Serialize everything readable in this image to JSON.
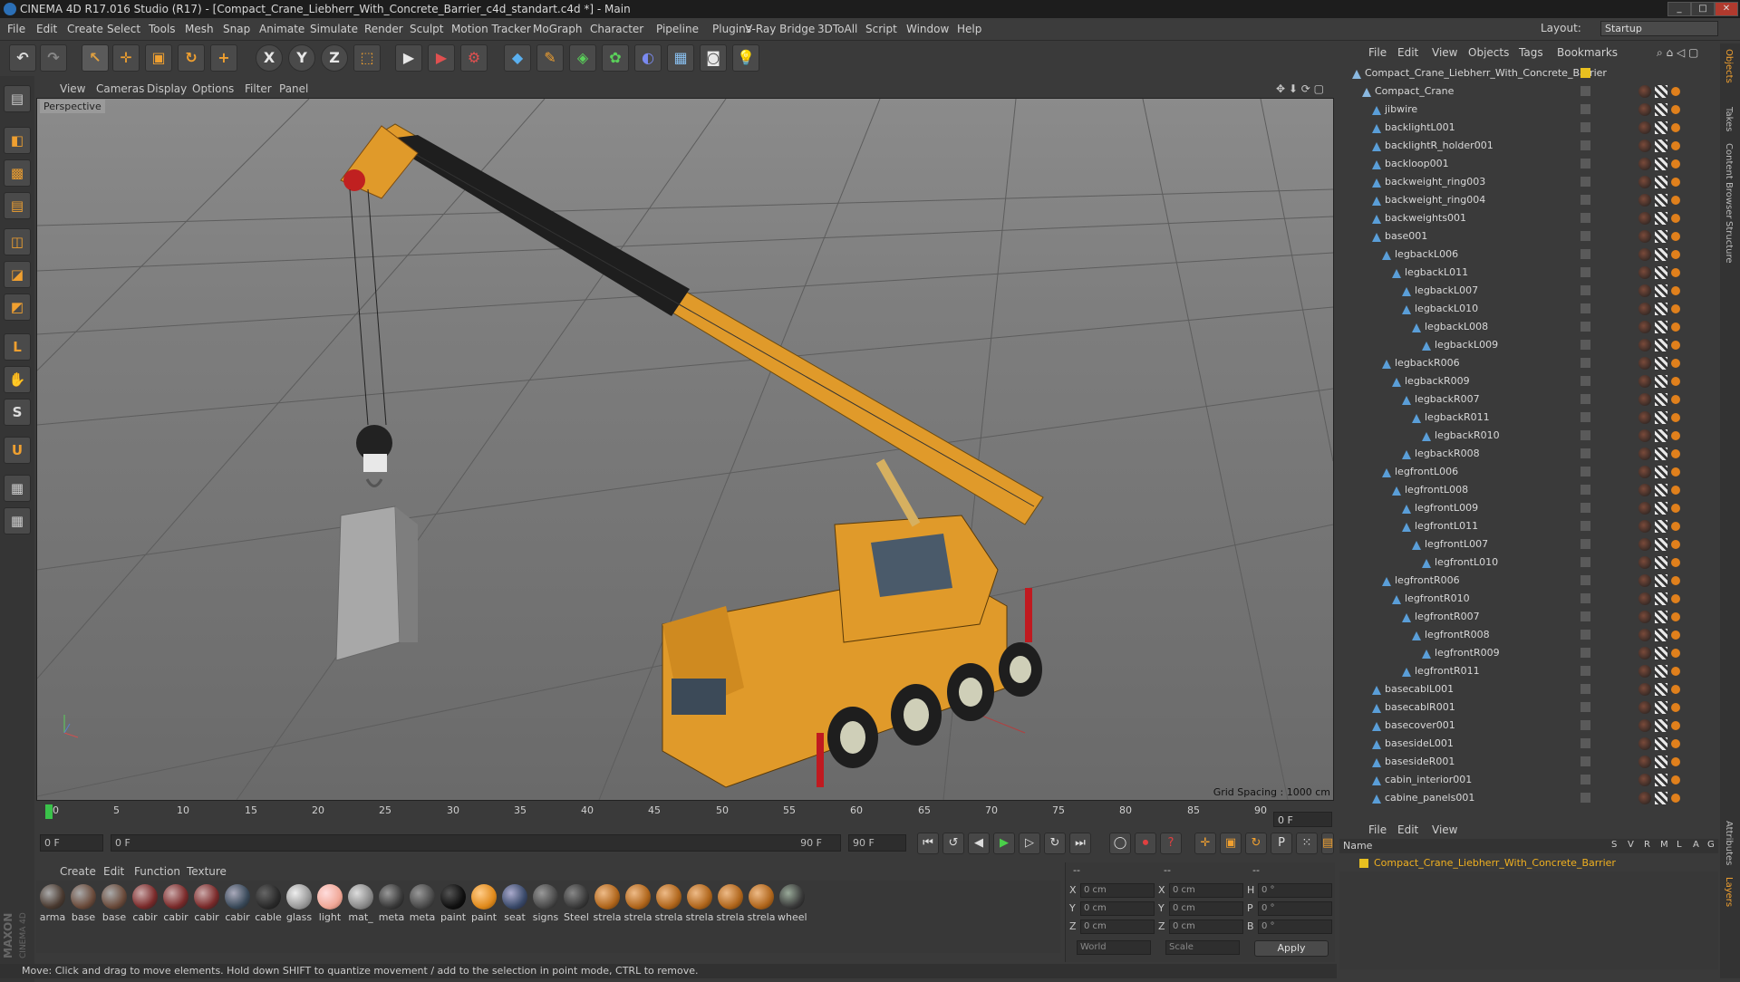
{
  "window": {
    "title": "CINEMA 4D R17.016 Studio (R17) - [Compact_Crane_Liebherr_With_Concrete_Barrier_c4d_standart.c4d *] - Main",
    "minimize": "_",
    "maximize": "□",
    "close": "✕"
  },
  "menu": [
    "File",
    "Edit",
    "Create",
    "Select",
    "Tools",
    "Mesh",
    "Snap",
    "Animate",
    "Simulate",
    "Render",
    "Sculpt",
    "Motion Tracker",
    "MoGraph",
    "Character",
    "Pipeline",
    "Plugins",
    "V-Ray Bridge",
    "3DToAll",
    "Script",
    "Window",
    "Help"
  ],
  "layout": {
    "label": "Layout:",
    "value": "Startup"
  },
  "toolbar": {
    "x": "X",
    "y": "Y",
    "z": "Z"
  },
  "viewport": {
    "menu": [
      "View",
      "Cameras",
      "Display",
      "Options",
      "Filter",
      "Panel"
    ],
    "label": "Perspective",
    "grid_spacing": "Grid Spacing : 1000 cm"
  },
  "timeline": {
    "ticks": [
      "0",
      "5",
      "10",
      "15",
      "20",
      "25",
      "30",
      "35",
      "40",
      "45",
      "50",
      "55",
      "60",
      "65",
      "70",
      "75",
      "80",
      "85",
      "90"
    ],
    "end_frame": "0 F",
    "current": "0 F",
    "range_start": "0 F",
    "range_end": "90 F",
    "range_end2": "90 F"
  },
  "materials": {
    "menu": [
      "Create",
      "Edit",
      "Function",
      "Texture"
    ],
    "items": [
      {
        "label": "arma",
        "color": "#4a3a30"
      },
      {
        "label": "base",
        "color": "#6a4a3a"
      },
      {
        "label": "base",
        "color": "#6a4a3a"
      },
      {
        "label": "cabir",
        "color": "#7a2a2a"
      },
      {
        "label": "cabir",
        "color": "#7a2a2a"
      },
      {
        "label": "cabir",
        "color": "#7a2a2a"
      },
      {
        "label": "cabir",
        "color": "#3a4a5a"
      },
      {
        "label": "cable",
        "color": "#2a2a2a"
      },
      {
        "label": "glass",
        "color": "#9a9a9a"
      },
      {
        "label": "light",
        "color": "#f0a898"
      },
      {
        "label": "mat_",
        "color": "#8a8a8a"
      },
      {
        "label": "meta",
        "color": "#3a3a3a"
      },
      {
        "label": "meta",
        "color": "#4a4a4a"
      },
      {
        "label": "paint",
        "color": "#101010"
      },
      {
        "label": "paint",
        "color": "#e08a1c"
      },
      {
        "label": "seat",
        "color": "#3a4a6a"
      },
      {
        "label": "signs",
        "color": "#4a4a4a"
      },
      {
        "label": "Steel",
        "color": "#3a3a3a"
      },
      {
        "label": "strela",
        "color": "#b0661c"
      },
      {
        "label": "strela",
        "color": "#b0661c"
      },
      {
        "label": "strela",
        "color": "#b0661c"
      },
      {
        "label": "strela",
        "color": "#b0661c"
      },
      {
        "label": "strela",
        "color": "#b0661c"
      },
      {
        "label": "strela",
        "color": "#b0661c"
      },
      {
        "label": "wheel",
        "color": "#3a3a3a"
      }
    ]
  },
  "coords": {
    "header": "--",
    "x_label": "X",
    "y_label": "Y",
    "z_label": "Z",
    "x_val": "0 cm",
    "y_val": "0 cm",
    "z_val": "0 cm",
    "x2_val": "0 cm",
    "y2_val": "0 cm",
    "z2_val": "0 cm",
    "h_label": "H",
    "p_label": "P",
    "b_label": "B",
    "h_val": "0 °",
    "p_val": "0 °",
    "b_val": "0 °",
    "mode1": "World",
    "mode2": "Scale",
    "apply": "Apply"
  },
  "status": "Move: Click and drag to move elements. Hold down SHIFT to quantize movement / add to the selection in point mode, CTRL to remove.",
  "brand": {
    "maxon": "MAXON",
    "c4d": "CINEMA 4D"
  },
  "objects": {
    "menu": [
      "File",
      "Edit",
      "View",
      "Objects",
      "Tags",
      "Bookmarks"
    ],
    "rows": [
      {
        "name": "Compact_Crane_Liebherr_With_Concrete_Barrier",
        "level": 0
      },
      {
        "name": "Compact_Crane",
        "level": 1
      },
      {
        "name": "jibwire",
        "level": 2
      },
      {
        "name": "backlightL001",
        "level": 2
      },
      {
        "name": "backlightR_holder001",
        "level": 2
      },
      {
        "name": "backloop001",
        "level": 2
      },
      {
        "name": "backweight_ring003",
        "level": 2
      },
      {
        "name": "backweight_ring004",
        "level": 2
      },
      {
        "name": "backweights001",
        "level": 2
      },
      {
        "name": "base001",
        "level": 2
      },
      {
        "name": "legbackL006",
        "level": 3
      },
      {
        "name": "legbackL011",
        "level": 4
      },
      {
        "name": "legbackL007",
        "level": 5
      },
      {
        "name": "legbackL010",
        "level": 5
      },
      {
        "name": "legbackL008",
        "level": 6
      },
      {
        "name": "legbackL009",
        "level": 7
      },
      {
        "name": "legbackR006",
        "level": 3
      },
      {
        "name": "legbackR009",
        "level": 4
      },
      {
        "name": "legbackR007",
        "level": 5
      },
      {
        "name": "legbackR011",
        "level": 6
      },
      {
        "name": "legbackR010",
        "level": 7
      },
      {
        "name": "legbackR008",
        "level": 5
      },
      {
        "name": "legfrontL006",
        "level": 3
      },
      {
        "name": "legfrontL008",
        "level": 4
      },
      {
        "name": "legfrontL009",
        "level": 5
      },
      {
        "name": "legfrontL011",
        "level": 5
      },
      {
        "name": "legfrontL007",
        "level": 6
      },
      {
        "name": "legfrontL010",
        "level": 7
      },
      {
        "name": "legfrontR006",
        "level": 3
      },
      {
        "name": "legfrontR010",
        "level": 4
      },
      {
        "name": "legfrontR007",
        "level": 5
      },
      {
        "name": "legfrontR008",
        "level": 6
      },
      {
        "name": "legfrontR009",
        "level": 7
      },
      {
        "name": "legfrontR011",
        "level": 5
      },
      {
        "name": "basecablL001",
        "level": 2
      },
      {
        "name": "basecablR001",
        "level": 2
      },
      {
        "name": "basecover001",
        "level": 2
      },
      {
        "name": "basesideL001",
        "level": 2
      },
      {
        "name": "basesideR001",
        "level": 2
      },
      {
        "name": "cabin_interior001",
        "level": 2
      },
      {
        "name": "cabine_panels001",
        "level": 2
      }
    ]
  },
  "side_tabs": [
    "Objects",
    "Takes",
    "Content Browser",
    "Structure"
  ],
  "side_tabs2": [
    "Attributes",
    "Layers"
  ],
  "layers": {
    "menu": [
      "File",
      "Edit",
      "View"
    ],
    "name_header": "Name",
    "cols": [
      "S",
      "V",
      "R",
      "M",
      "L",
      "A",
      "G"
    ],
    "row": "Compact_Crane_Liebherr_With_Concrete_Barrier"
  }
}
